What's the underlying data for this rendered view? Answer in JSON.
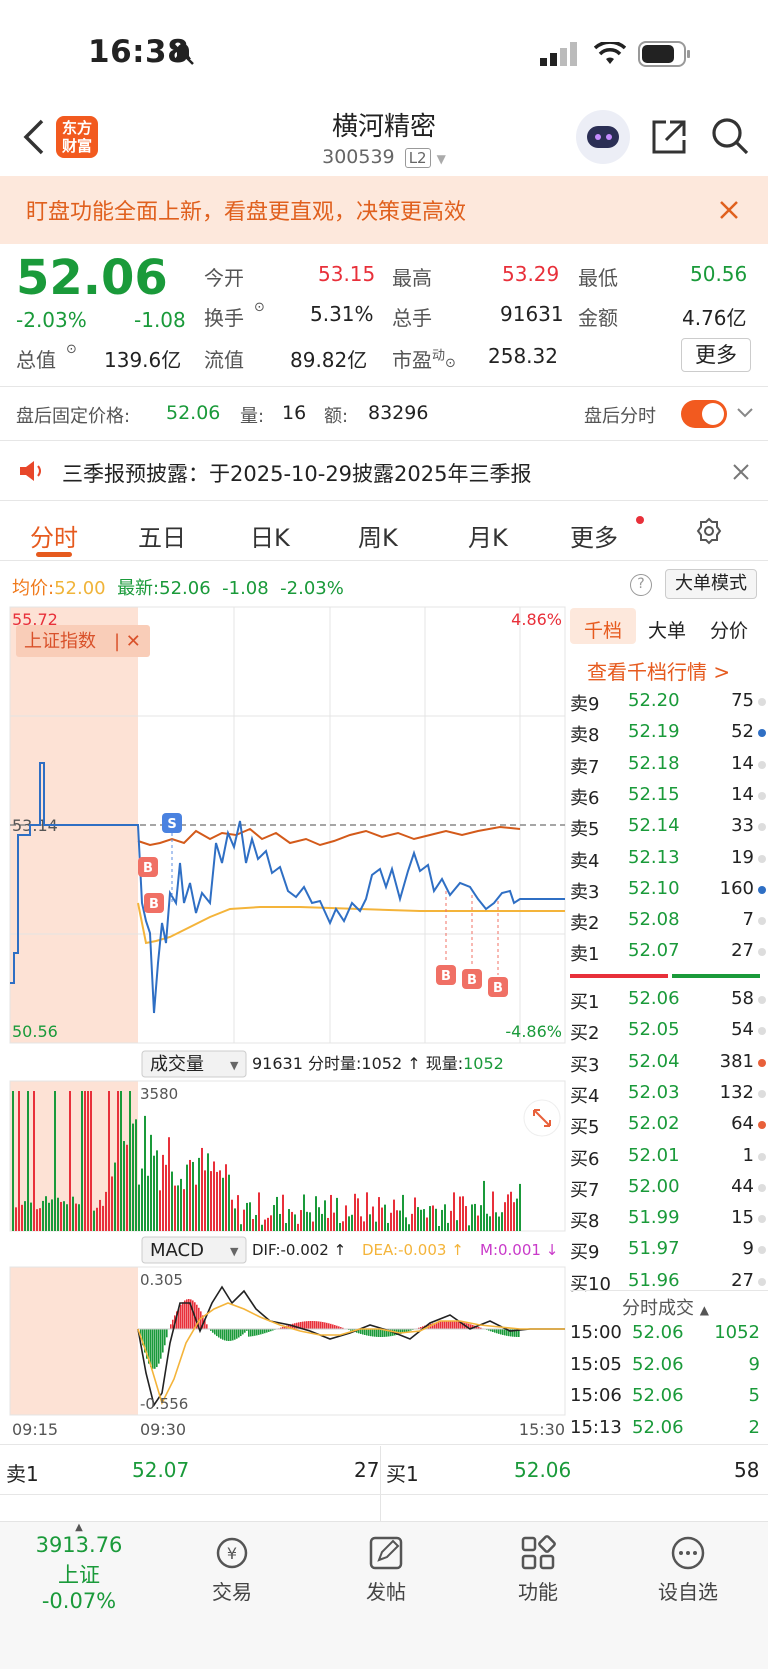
{
  "status_bar": {
    "time": "16:38"
  },
  "header": {
    "logo_text_1": "东方",
    "logo_text_2": "财富",
    "stock_name": "横河精密",
    "stock_code": "300539",
    "level_badge": "L2"
  },
  "banner": {
    "text": "盯盘功能全面上新，看盘更直观，决策更高效"
  },
  "quote": {
    "price": "52.06",
    "change_pct": "-2.03%",
    "change_amt": "-1.08",
    "fields": [
      {
        "label": "今开",
        "value": "53.15",
        "color": "red"
      },
      {
        "label": "最高",
        "value": "53.29",
        "color": "red"
      },
      {
        "label": "最低",
        "value": "50.56",
        "color": "green"
      },
      {
        "label": "换手",
        "value": "5.31%",
        "color": "black"
      },
      {
        "label": "总手",
        "value": "91631",
        "color": "black"
      },
      {
        "label": "金额",
        "value": "4.76亿",
        "color": "black"
      },
      {
        "label": "总值",
        "value": "139.6亿",
        "color": "black"
      },
      {
        "label": "流值",
        "value": "89.82亿",
        "color": "black"
      },
      {
        "label": "市盈",
        "sup": "动",
        "value": "258.32",
        "color": "black"
      }
    ],
    "more_label": "更多"
  },
  "after_hours": {
    "label": "盘后固定价格:",
    "price": "52.06",
    "vol_label": "量:",
    "vol": "16",
    "amt_label": "额:",
    "amt": "83296",
    "toggle_label": "盘后分时"
  },
  "notice": {
    "text": "三季报预披露：于2025-10-29披露2025年三季报"
  },
  "tabs": [
    "分时",
    "五日",
    "日K",
    "周K",
    "月K",
    "更多"
  ],
  "chart_header": {
    "avg_label": "均价:",
    "avg": "52.00",
    "latest_label": "最新:",
    "latest": "52.06",
    "chg": "-1.08",
    "pct": "-2.03%",
    "big_mode": "大单模式"
  },
  "chart_data": {
    "type": "line",
    "price_axis": {
      "top": "55.72",
      "mid": "53.14",
      "bottom": "50.56",
      "pct_top": "4.86%",
      "pct_bottom": "-4.86%"
    },
    "overlay_index": "上证指数",
    "time_labels": [
      "09:15",
      "09:30",
      "15:30"
    ],
    "volume_header": {
      "label": "成交量",
      "total": "91631",
      "fs_label": "分时量:",
      "fs": "1052",
      "now_label": "现量:",
      "now": "1052",
      "ymax": "3580"
    },
    "macd_header": {
      "label": "MACD",
      "dif": "DIF:-0.002",
      "dea": "DEA:-0.003",
      "m": "M:0.001",
      "ymax": "0.305",
      "ymin": "-0.556"
    },
    "markers": [
      "S",
      "B",
      "B",
      "B",
      "B",
      "B"
    ]
  },
  "order_book": {
    "tabs": [
      "千档",
      "大单",
      "分价"
    ],
    "link": "查看千档行情 >",
    "asks": [
      {
        "label": "卖9",
        "price": "52.20",
        "vol": "75"
      },
      {
        "label": "卖8",
        "price": "52.19",
        "vol": "52"
      },
      {
        "label": "卖7",
        "price": "52.18",
        "vol": "14"
      },
      {
        "label": "卖6",
        "price": "52.15",
        "vol": "14"
      },
      {
        "label": "卖5",
        "price": "52.14",
        "vol": "33"
      },
      {
        "label": "卖4",
        "price": "52.13",
        "vol": "19"
      },
      {
        "label": "卖3",
        "price": "52.10",
        "vol": "160"
      },
      {
        "label": "卖2",
        "price": "52.08",
        "vol": "7"
      },
      {
        "label": "卖1",
        "price": "52.07",
        "vol": "27"
      }
    ],
    "bids": [
      {
        "label": "买1",
        "price": "52.06",
        "vol": "58"
      },
      {
        "label": "买2",
        "price": "52.05",
        "vol": "54"
      },
      {
        "label": "买3",
        "price": "52.04",
        "vol": "381"
      },
      {
        "label": "买4",
        "price": "52.03",
        "vol": "132"
      },
      {
        "label": "买5",
        "price": "52.02",
        "vol": "64"
      },
      {
        "label": "买6",
        "price": "52.01",
        "vol": "1"
      },
      {
        "label": "买7",
        "price": "52.00",
        "vol": "44"
      },
      {
        "label": "买8",
        "price": "51.99",
        "vol": "15"
      },
      {
        "label": "买9",
        "price": "51.97",
        "vol": "9"
      },
      {
        "label": "买10",
        "price": "51.96",
        "vol": "27"
      }
    ],
    "trades_title": "分时成交",
    "trades": [
      {
        "time": "15:00",
        "price": "52.06",
        "vol": "1052"
      },
      {
        "time": "15:05",
        "price": "52.06",
        "vol": "9"
      },
      {
        "time": "15:06",
        "price": "52.06",
        "vol": "5"
      },
      {
        "time": "15:13",
        "price": "52.06",
        "vol": "2"
      }
    ]
  },
  "level1": {
    "ask_label": "卖1",
    "ask_price": "52.07",
    "ask_vol": "27",
    "bid_label": "买1",
    "bid_price": "52.06",
    "bid_vol": "58"
  },
  "bottom_nav": {
    "index_value": "3913.76",
    "index_label": "上证 -0.07%",
    "items": [
      "交易",
      "发帖",
      "功能",
      "设自选"
    ]
  }
}
